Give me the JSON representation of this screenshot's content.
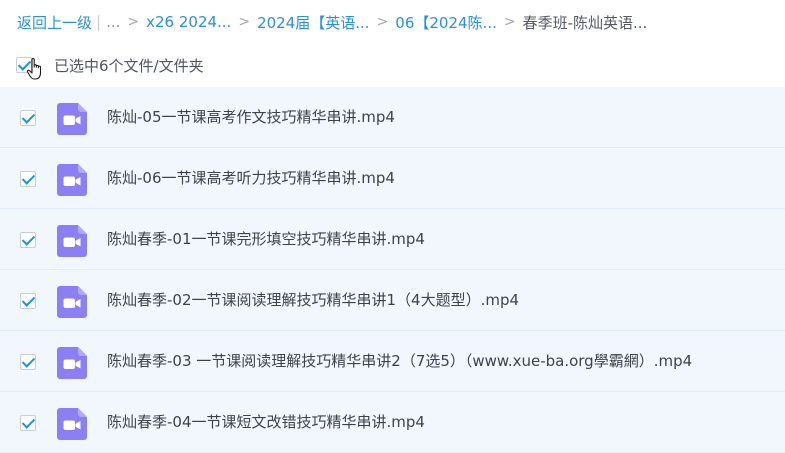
{
  "breadcrumb": {
    "back": "返回上一级",
    "ellipsis": "...",
    "items": [
      "x26 2024...",
      "2024届【英语...",
      "06【2024陈...",
      "春季班-陈灿英语..."
    ]
  },
  "selection": {
    "label": "已选中6个文件/文件夹",
    "checked": true
  },
  "files": [
    {
      "name": "陈灿-05一节课高考作文技巧精华串讲.mp4",
      "checked": true
    },
    {
      "name": "陈灿-06一节课高考听力技巧精华串讲.mp4",
      "checked": true
    },
    {
      "name": "陈灿春季-01一节课完形填空技巧精华串讲.mp4",
      "checked": true
    },
    {
      "name": "陈灿春季-02一节课阅读理解技巧精华串讲1（4大题型）.mp4",
      "checked": true
    },
    {
      "name": "陈灿春季-03 一节课阅读理解技巧精华串讲2（7选5）（www.xue-ba.org學霸網）.mp4",
      "checked": true
    },
    {
      "name": "陈灿春季-04一节课短文改错技巧精华串讲.mp4",
      "checked": true
    }
  ],
  "colors": {
    "link": "#2a8fe0",
    "row_bg": "#f2f7fd",
    "check": "#1f8fe6",
    "video_icon": "#8b7ff3"
  },
  "icons": {
    "file_type": "video-file-icon",
    "cursor": "hand-pointer-icon"
  }
}
